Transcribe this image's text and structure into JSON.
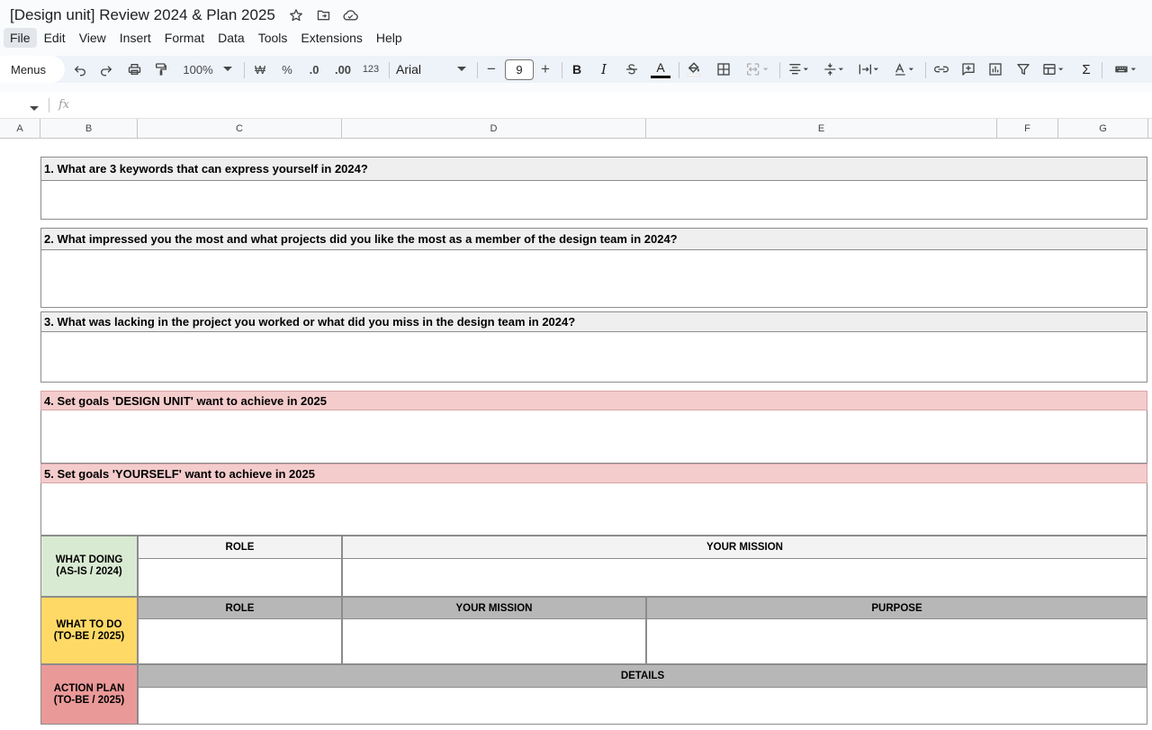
{
  "app": {
    "doc_title": "[Design unit] Review 2024 & Plan 2025",
    "title_icons": [
      "star-icon",
      "move-to-folder-icon",
      "cloud-status-icon"
    ]
  },
  "menubar": {
    "items": [
      "File",
      "Edit",
      "View",
      "Insert",
      "Format",
      "Data",
      "Tools",
      "Extensions",
      "Help"
    ]
  },
  "toolbar": {
    "menus_label": "Menus",
    "zoom": "100%",
    "currency": "₩",
    "percent": "%",
    "decrease_decimal": ".0",
    "increase_decimal": ".00",
    "more_formats": "123",
    "font": "Arial",
    "font_size": "9",
    "minus": "−",
    "plus": "+",
    "bold": "B",
    "italic": "I",
    "text_color": "A",
    "sum": "Σ"
  },
  "formula_bar": {
    "fx": "fx"
  },
  "columns": [
    "A",
    "B",
    "C",
    "D",
    "E",
    "F",
    "G"
  ],
  "sheet": {
    "q1": "1. What are 3 keywords that can express yourself in 2024?",
    "q2": "2. What impressed you the most and what projects did you like the most as a member of the design team in 2024?",
    "q3": "3. What was lacking in the project you worked or what did you miss in the design team in 2024?",
    "q4": "4. Set goals 'DESIGN UNIT' want to achieve in 2025",
    "q5": "5. Set goals 'YOURSELF' want to achieve in 2025",
    "what_doing": "WHAT DOING\n(AS-IS / 2024)",
    "what_doing_role": "ROLE",
    "what_doing_mission": "YOUR MISSION",
    "what_to_do": "WHAT TO DO\n(TO-BE / 2025)",
    "what_to_do_role": "ROLE",
    "what_to_do_mission": "YOUR MISSION",
    "what_to_do_purpose": "PURPOSE",
    "action_plan": "ACTION PLAN\n(TO-BE / 2025)",
    "action_plan_details": "DETAILS"
  },
  "colors": {
    "question_header": "#efefef",
    "goal_header": "#f4cccc",
    "what_doing_bg": "#d9ead3",
    "what_to_do_bg": "#ffd966",
    "action_plan_bg": "#ea9999",
    "table_header_dark": "#b7b7b7",
    "table_header_light": "#f3f3f3"
  }
}
